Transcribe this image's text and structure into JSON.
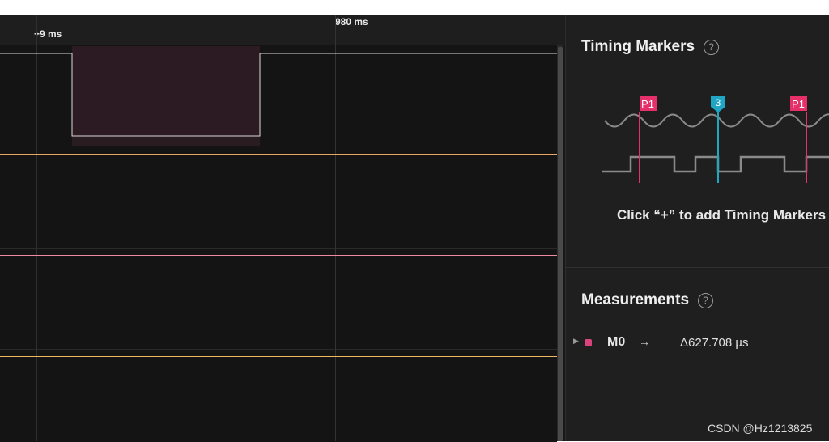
{
  "ruler": {
    "major_label": "980 ms",
    "minor_label": "+9 ms"
  },
  "timing_markers": {
    "title": "Timing Markers",
    "help_glyph": "?",
    "marker_labels": [
      "P1",
      "3",
      "P1"
    ],
    "hint": "Click “+” to add Timing Markers"
  },
  "measurements": {
    "title": "Measurements",
    "help_glyph": "?",
    "rows": [
      {
        "name": "M0",
        "arrow": "→",
        "value": "Δ627.708 µs",
        "color": "#d9447c"
      }
    ]
  },
  "watermark": "CSDN @Hz1213825",
  "colors": {
    "channel_1": "#d8d8d8",
    "channel_2": "#e7a766",
    "channel_3": "#f08aa0",
    "channel_4": "#f0b860",
    "marker_pink": "#e6306a",
    "marker_teal": "#1fa6c4"
  }
}
